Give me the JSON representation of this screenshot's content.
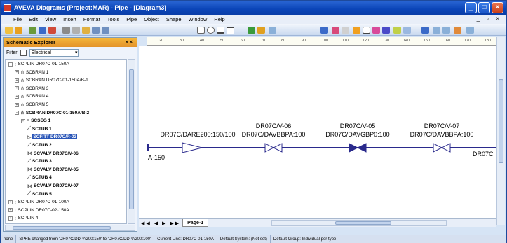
{
  "window": {
    "title": "AVEVA Diagrams (Project:MAR) - Pipe - [Diagram3]"
  },
  "menu": [
    "File",
    "Edit",
    "View",
    "Insert",
    "Format",
    "Tools",
    "Pipe",
    "Object",
    "Shape",
    "Window",
    "Help"
  ],
  "explorer": {
    "title": "Schematic Explorer",
    "close": "× ×",
    "filter_label": "Filter",
    "filter_value": "Electrical",
    "tree": [
      {
        "label": "SCPLIN DR07C-01-150A",
        "indent": 0,
        "bold": false,
        "pm": "-",
        "icon": "pipeline-icon"
      },
      {
        "label": "SCBRAN 1",
        "indent": 1,
        "bold": false,
        "pm": "+",
        "icon": "branch-icon"
      },
      {
        "label": "SCBRAN DR07C-01-150A/B-1",
        "indent": 1,
        "bold": false,
        "pm": "+",
        "icon": "branch-icon"
      },
      {
        "label": "SCBRAN 3",
        "indent": 1,
        "bold": false,
        "pm": "+",
        "icon": "branch-icon"
      },
      {
        "label": "SCBRAN 4",
        "indent": 1,
        "bold": false,
        "pm": "+",
        "icon": "branch-icon"
      },
      {
        "label": "SCBRAN 5",
        "indent": 1,
        "bold": false,
        "pm": "+",
        "icon": "branch-icon"
      },
      {
        "label": "SCBRAN DR07C-01-150A/B-2",
        "indent": 1,
        "bold": true,
        "pm": "-",
        "icon": "branch-icon"
      },
      {
        "label": "SCSEG 1",
        "indent": 2,
        "bold": true,
        "pm": "-",
        "icon": "segment-icon"
      },
      {
        "label": "SCTUB 1",
        "indent": 3,
        "bold": true,
        "pm": "",
        "icon": "tube-icon"
      },
      {
        "label": "SCFITT DR07C/R-03",
        "indent": 3,
        "bold": true,
        "pm": "",
        "icon": "fitting-icon",
        "selected": true
      },
      {
        "label": "SCTUB 2",
        "indent": 3,
        "bold": true,
        "pm": "",
        "icon": "tube-icon"
      },
      {
        "label": "SCVALV DR07C/V-06",
        "indent": 3,
        "bold": true,
        "pm": "",
        "icon": "valve-icon"
      },
      {
        "label": "SCTUB 3",
        "indent": 3,
        "bold": true,
        "pm": "",
        "icon": "tube-icon"
      },
      {
        "label": "SCVALV DR07C/V-05",
        "indent": 3,
        "bold": true,
        "pm": "",
        "icon": "valve-icon"
      },
      {
        "label": "SCTUB 4",
        "indent": 3,
        "bold": true,
        "pm": "",
        "icon": "tube-icon"
      },
      {
        "label": "SCVALV DR07C/V-07",
        "indent": 3,
        "bold": true,
        "pm": "",
        "icon": "valve-icon"
      },
      {
        "label": "SCTUB 5",
        "indent": 3,
        "bold": true,
        "pm": "",
        "icon": "tube-icon"
      },
      {
        "label": "SCPLIN DR07C-01-100A",
        "indent": 0,
        "bold": false,
        "pm": "+",
        "icon": "pipeline-icon"
      },
      {
        "label": "SCPLIN DR07C-02-150A",
        "indent": 0,
        "bold": false,
        "pm": "+",
        "icon": "pipeline-icon"
      },
      {
        "label": "SCPLIN 4",
        "indent": 0,
        "bold": false,
        "pm": "+",
        "icon": "pipeline-icon"
      }
    ]
  },
  "ruler": {
    "h_ticks": [
      "20",
      "30",
      "40",
      "50",
      "60",
      "70",
      "80",
      "90",
      "100",
      "110",
      "120",
      "130",
      "140",
      "150",
      "160",
      "170",
      "180"
    ],
    "v_ticks": [
      "180",
      "170",
      "160",
      "150",
      "140",
      "130",
      "120",
      "110"
    ]
  },
  "diagram": {
    "fitting": {
      "top": "",
      "bottom": "DR07C/DARE200:150/100"
    },
    "valves": [
      {
        "top": "DR07C/V-06",
        "bottom": "DR07C/DAVBBPA:100"
      },
      {
        "top": "DR07C/V-05",
        "bottom": "DR07C/DAVGBP0:100"
      },
      {
        "top": "DR07C/V-07",
        "bottom": "DR07C/DAVBBPA:100"
      }
    ],
    "pipe_label": "A-150",
    "right_label": "DR07C"
  },
  "page_tab": "Page-1",
  "status": {
    "mode": "none",
    "message": "SPRE changed from 'DR07C/DDPA200:150' to 'DR07C/DDPA200:100'",
    "current_line": "Current Line: DR07C-01-150A",
    "default_system": "Default System: (Not set)",
    "default_group": "Default Group: Individual per type"
  },
  "colors": {
    "pipe": "#2a2a8c",
    "selection": "#2a56b8",
    "titlebar": "#0b45b8"
  }
}
